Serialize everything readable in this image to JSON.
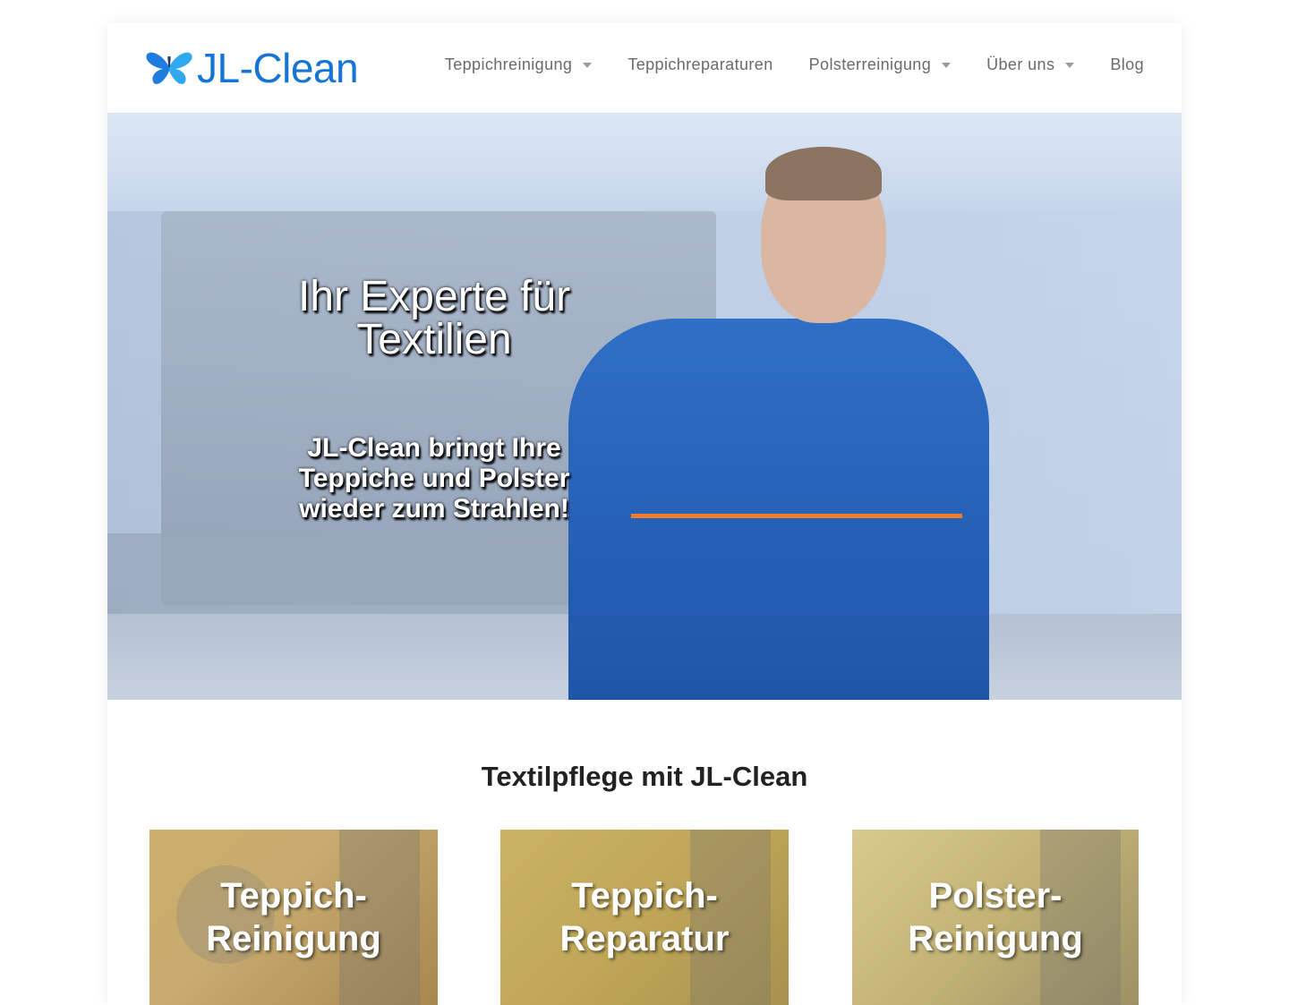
{
  "header": {
    "logo_text": "JL-Clean",
    "logo_icon": "butterfly-icon",
    "nav": [
      {
        "label": "Teppichreinigung",
        "has_dropdown": true
      },
      {
        "label": "Teppichreparaturen",
        "has_dropdown": false
      },
      {
        "label": "Polsterreinigung",
        "has_dropdown": true
      },
      {
        "label": "Über uns",
        "has_dropdown": true
      },
      {
        "label": "Blog",
        "has_dropdown": false
      }
    ]
  },
  "hero": {
    "title": "Ihr Experte für Textilien",
    "subtitle": "JL-Clean bringt Ihre Teppiche und Polster wieder zum Strahlen!"
  },
  "section": {
    "title": "Textilpflege mit JL-Clean"
  },
  "cards": [
    {
      "label": "Teppich-Reinigung"
    },
    {
      "label": "Teppich-Reparatur"
    },
    {
      "label": "Polster-Reinigung"
    }
  ],
  "colors": {
    "brand_blue": "#1574d4",
    "nav_text": "#6a6a6a",
    "heading": "#222222"
  }
}
